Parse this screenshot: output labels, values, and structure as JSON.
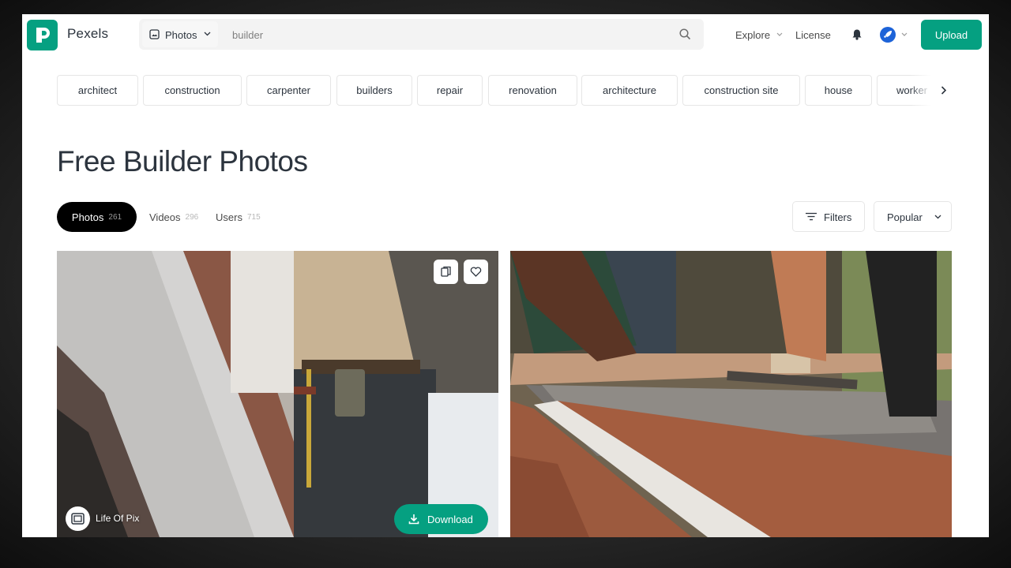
{
  "header": {
    "brand": "Pexels",
    "search_type": "Photos",
    "search_value": "builder",
    "nav": {
      "explore": "Explore",
      "license": "License"
    },
    "upload_label": "Upload"
  },
  "tags": [
    "architect",
    "construction",
    "carpenter",
    "builders",
    "repair",
    "renovation",
    "architecture",
    "construction site",
    "house",
    "worker"
  ],
  "page_title": "Free Builder Photos",
  "tabs": [
    {
      "label": "Photos",
      "count": "261"
    },
    {
      "label": "Videos",
      "count": "296"
    },
    {
      "label": "Users",
      "count": "715"
    }
  ],
  "controls": {
    "filters_label": "Filters",
    "sort_label": "Popular"
  },
  "photos": [
    {
      "photographer": "Life Of Pix",
      "download_label": "Download"
    }
  ],
  "colors": {
    "accent": "#05a081",
    "text": "#2c343e",
    "avatar": "#1d63d8"
  },
  "icons": [
    "pexels-logo-icon",
    "image-icon",
    "chevron-down-icon",
    "search-icon",
    "bell-icon",
    "rocket-icon",
    "chevron-right-icon",
    "sliders-icon",
    "collection-icon",
    "heart-icon",
    "download-icon"
  ]
}
